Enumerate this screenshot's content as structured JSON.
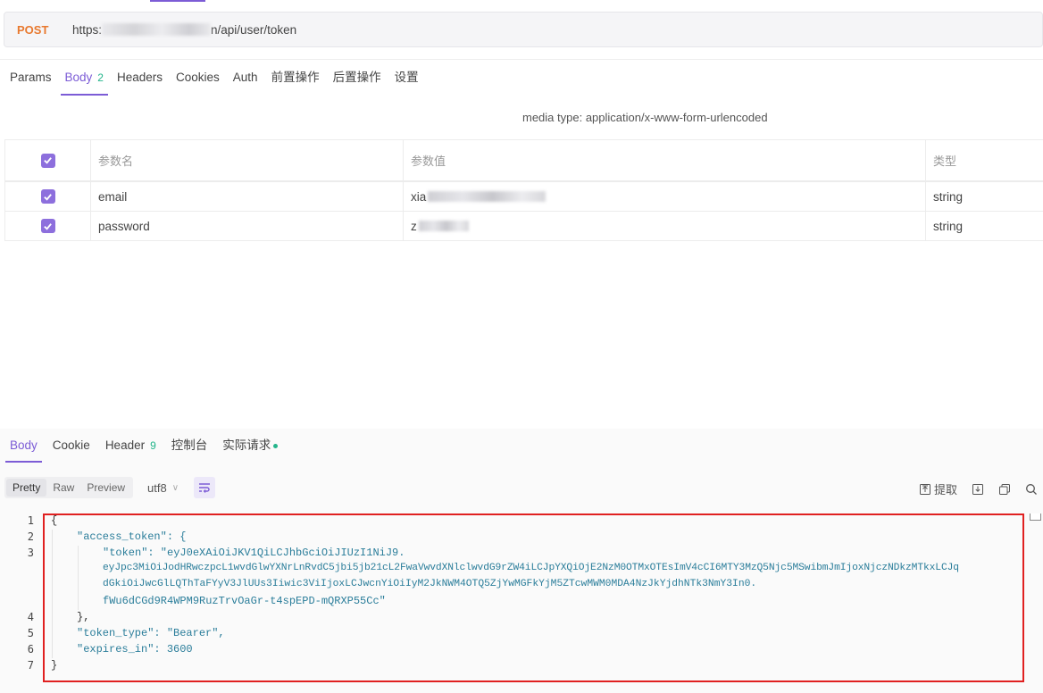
{
  "request": {
    "method": "POST",
    "url_prefix": "https:",
    "url_suffix": "n/api/user/token"
  },
  "req_tabs": [
    {
      "label": "Params"
    },
    {
      "label": "Body",
      "badge": "2"
    },
    {
      "label": "Headers"
    },
    {
      "label": "Cookies"
    },
    {
      "label": "Auth"
    },
    {
      "label": "前置操作"
    },
    {
      "label": "后置操作"
    },
    {
      "label": "设置"
    }
  ],
  "media_type": "media type: application/x-www-form-urlencoded",
  "params_table": {
    "headers": [
      "参数名",
      "参数值",
      "类型"
    ],
    "rows": [
      {
        "name": "email",
        "value": "xia",
        "type": "string"
      },
      {
        "name": "password",
        "value": "z",
        "type": "string"
      }
    ]
  },
  "resp_tabs": [
    {
      "label": "Body"
    },
    {
      "label": "Cookie"
    },
    {
      "label": "Header",
      "badge": "9"
    },
    {
      "label": "控制台"
    },
    {
      "label": "实际请求"
    }
  ],
  "view_modes": [
    "Pretty",
    "Raw",
    "Preview"
  ],
  "encoding": "utf8",
  "tools": {
    "extract": "提取"
  },
  "code": {
    "line_numbers": [
      "1",
      "2",
      "3",
      "4",
      "5",
      "6",
      "7"
    ],
    "lines": [
      "{",
      "\"access_token\": {",
      "\"token\": \"eyJ0eXAiOiJKV1QiLCJhbGciOiJIUzI1NiJ9.",
      "eyJpc3MiOiJodHRwczpcL1wvdGlwYXNrLnRvdC5jbi5jb21cL2FwaVwvdXNlclwvdG9rZW4iLCJpYXQiOjE2NzM0OTMxOTEsImV4cCI6MTY3MzQ5Njc5MSwibmJmIjoxNjczNDkzMTkxLCJq",
      "dGkiOiJwcGlLQThTaFYyV3JlUUs3Iiwic3ViIjoxLCJwcnYiOiIyM2JkNWM4OTQ5ZjYwMGFkYjM5ZTcwMWM0MDA4NzJkYjdhNTk3NmY3In0.",
      "fWu6dCGd9R4WPM9RuzTrvOaGr-t4spEPD-mQRXP55Cc\"",
      "},",
      "\"token_type\": \"Bearer\",",
      "\"expires_in\": 3600",
      "}"
    ]
  }
}
